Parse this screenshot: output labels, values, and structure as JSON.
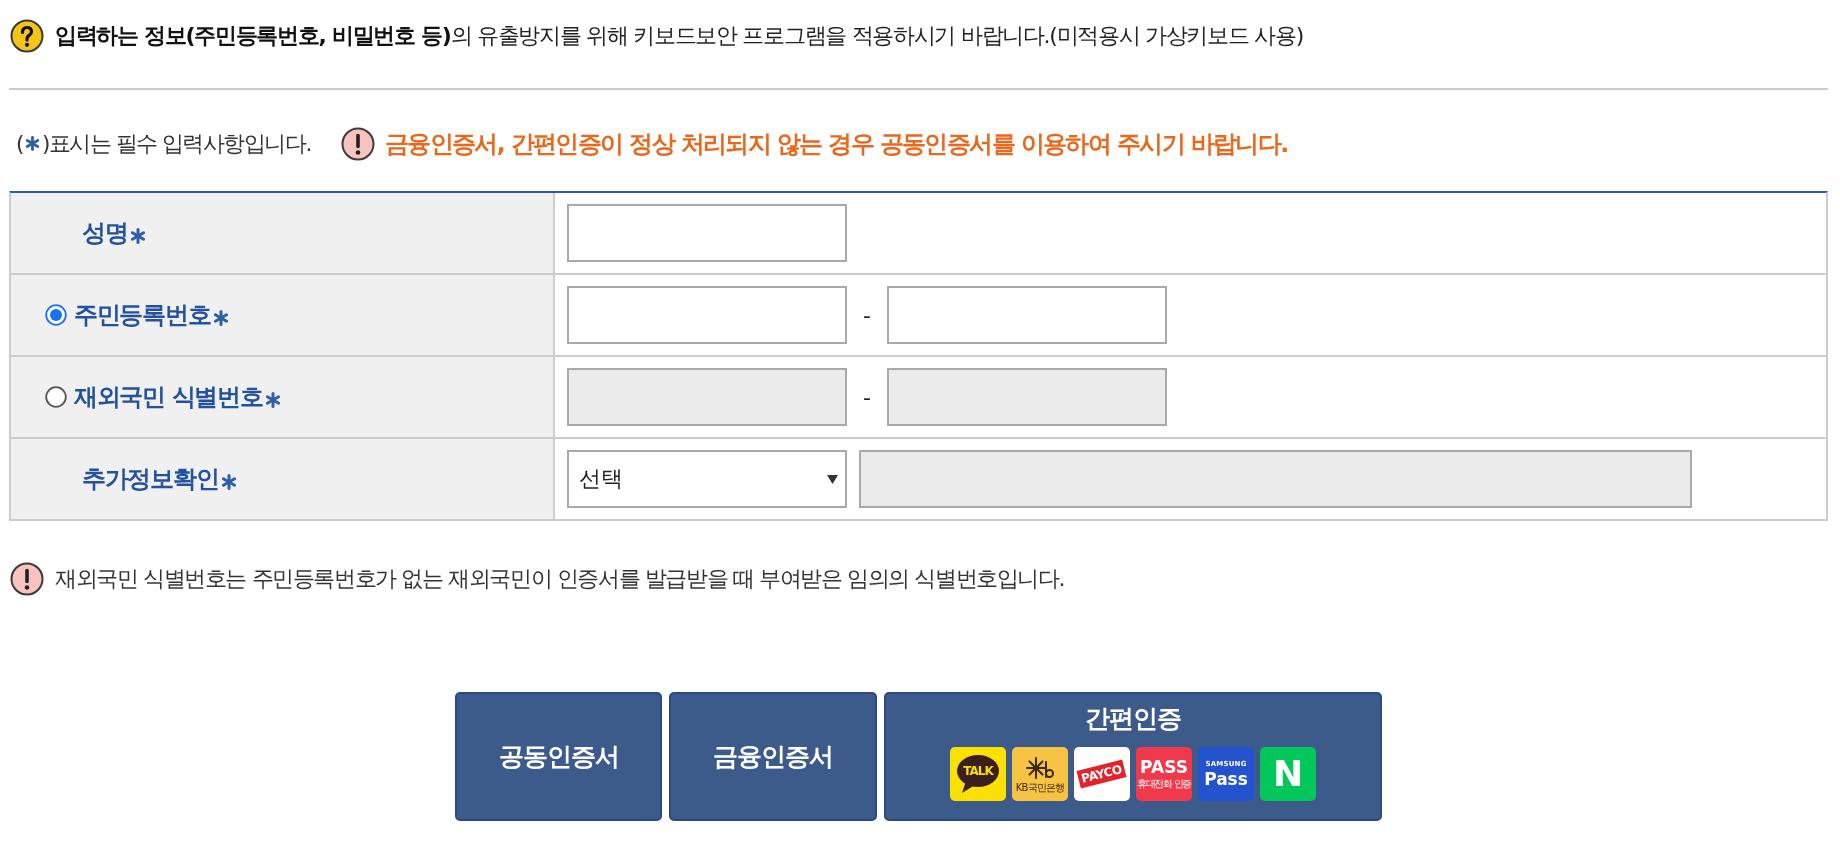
{
  "notice": {
    "text": "**입력하는 정보(주민등록번호, 비밀번호 등)**의 유출방지를 위해 키보드보안 프로그램을 적용하시기 바랍니다.(미적용시 가상키보드 사용)"
  },
  "required_note": {
    "open": "(",
    "text": ")표시는 필수 입력사항입니다."
  },
  "warning": {
    "text": "금융인증서, 간편인증이 정상 처리되지 않는 경우 공동인증서를 이용하여 주시기 바랍니다."
  },
  "form": {
    "rows": [
      {
        "kind": "text",
        "label": "성명",
        "required": true,
        "inputs": [
          {
            "disabled": false
          }
        ]
      },
      {
        "kind": "id_number",
        "label": "주민등록번호",
        "required": true,
        "selected": true,
        "separator": "-",
        "inputs": [
          {
            "disabled": false
          },
          {
            "disabled": false
          }
        ]
      },
      {
        "kind": "id_number",
        "label": "재외국민 식별번호",
        "required": true,
        "selected": false,
        "separator": "-",
        "inputs": [
          {
            "disabled": true
          },
          {
            "disabled": true
          }
        ]
      },
      {
        "kind": "select",
        "label": "추가정보확인",
        "required": true,
        "select": {
          "value": "선택"
        },
        "inputs": [
          {
            "disabled": true
          }
        ]
      }
    ]
  },
  "footnote": {
    "text": "재외국민 식별번호는 주민등록번호가 없는 재외국민이 인증서를 발급받을 때 부여받은 임의의 식별번호입니다."
  },
  "buttons": [
    {
      "kind": "text",
      "label": "공동인증서"
    },
    {
      "kind": "text",
      "label": "금융인증서"
    },
    {
      "kind": "providers",
      "label": "간편인증",
      "providers": [
        {
          "kind": "bubble",
          "color": "#fae100",
          "label": "TALK"
        },
        {
          "kind": "mark",
          "color": "#f6c343",
          "caption": "KB국민은행"
        },
        {
          "kind": "ribbon",
          "color": "#ffffff",
          "label": "PAYCO"
        },
        {
          "kind": "caption",
          "color": "#f0394b",
          "label": "PASS",
          "caption": "휴대전화 인증"
        },
        {
          "kind": "overline",
          "color": "#2453cf",
          "overline": "SAMSUNG",
          "label": "Pass"
        },
        {
          "kind": "letter",
          "color": "#03c75a",
          "label": "N"
        }
      ]
    }
  ]
}
